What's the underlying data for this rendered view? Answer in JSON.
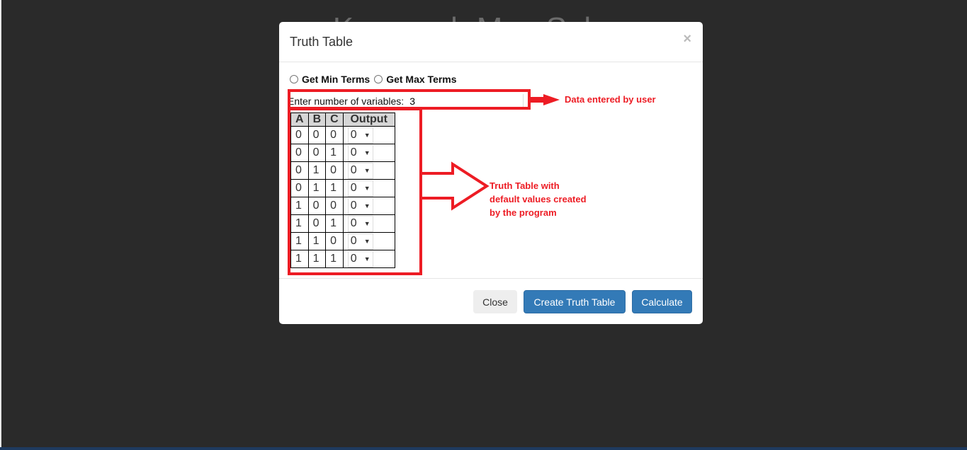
{
  "background": {
    "title": "Karnaugh Map Solver"
  },
  "modal": {
    "title": "Truth Table",
    "close_symbol": "×",
    "radio_min": "Get Min Terms",
    "radio_max": "Get Max Terms",
    "variables_label": "Enter number of variables:",
    "variables_value": "3",
    "table": {
      "headers": [
        "A",
        "B",
        "C",
        "Output"
      ],
      "rows": [
        [
          "0",
          "0",
          "0",
          "0"
        ],
        [
          "0",
          "0",
          "1",
          "0"
        ],
        [
          "0",
          "1",
          "0",
          "0"
        ],
        [
          "0",
          "1",
          "1",
          "0"
        ],
        [
          "1",
          "0",
          "0",
          "0"
        ],
        [
          "1",
          "0",
          "1",
          "0"
        ],
        [
          "1",
          "1",
          "0",
          "0"
        ],
        [
          "1",
          "1",
          "1",
          "0"
        ]
      ]
    },
    "buttons": {
      "close": "Close",
      "create": "Create Truth Table",
      "calculate": "Calculate"
    }
  },
  "annotations": {
    "input_note": "Data entered by user",
    "table_note": [
      "Truth Table with",
      "default values created",
      "by the program"
    ],
    "color": "#ed1c24"
  },
  "colors": {
    "primary": "#337ab7",
    "backdrop": "#2a2a2a"
  }
}
